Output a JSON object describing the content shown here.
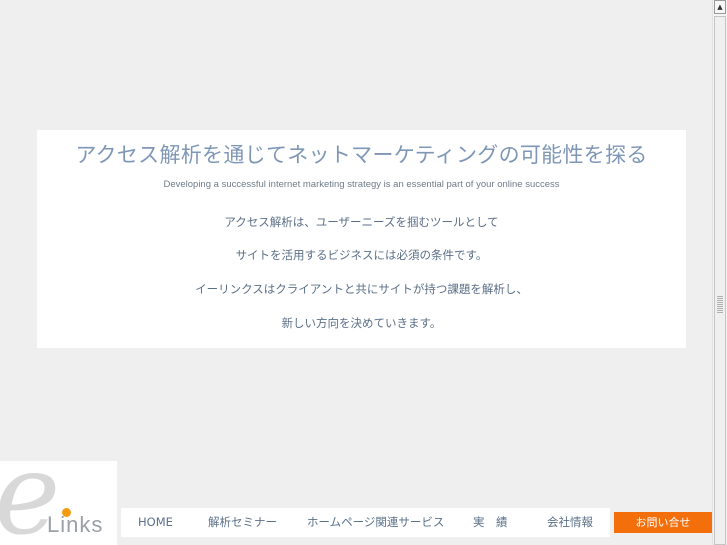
{
  "hero": {
    "title": "アクセス解析を通じてネットマーケティングの可能性を探る",
    "subtitle": "Developing a successful internet marketing strategy is an essential part of your online success",
    "lines": [
      "アクセス解析は、ユーザーニーズを掴むツールとして",
      "サイトを活用するビジネスには必須の条件です。",
      "イーリンクスはクライアントと共にサイトが持つ課題を解析し、",
      "新しい方向を決めていきます。"
    ]
  },
  "logo": {
    "text": "Links"
  },
  "nav": {
    "items": [
      "HOME",
      "解析セミナー",
      "ホームページ関連サービス",
      "実　績",
      "会社情報"
    ],
    "contact": "お問い合せ"
  },
  "colors": {
    "background": "#efefef",
    "title": "#7f97b6",
    "body_text": "#5b6f87",
    "accent": "#f26f0c"
  },
  "icons": {
    "scroll_up": "triangle-up"
  }
}
